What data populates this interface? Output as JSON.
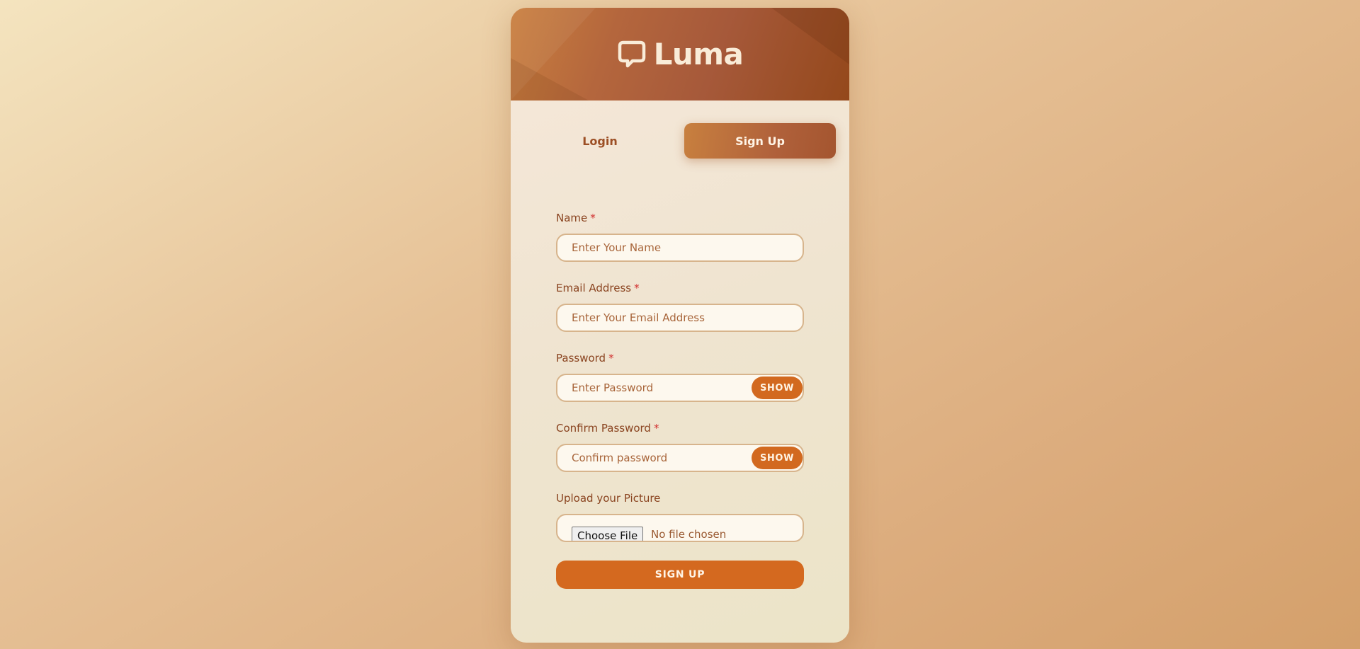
{
  "brand": {
    "name": "Luma",
    "icon": "chat-bubble-icon"
  },
  "tabs": [
    {
      "label": "Login",
      "active": false
    },
    {
      "label": "Sign Up",
      "active": true
    }
  ],
  "form": {
    "name": {
      "label": "Name",
      "required_mark": "*",
      "placeholder": "Enter Your Name",
      "value": ""
    },
    "email": {
      "label": "Email Address",
      "required_mark": "*",
      "placeholder": "Enter Your Email Address",
      "value": ""
    },
    "password": {
      "label": "Password",
      "required_mark": "*",
      "placeholder": "Enter Password",
      "value": "",
      "toggle_label": "SHOW"
    },
    "confirm_password": {
      "label": "Confirm Password",
      "required_mark": "*",
      "placeholder": "Confirm password",
      "value": "",
      "toggle_label": "SHOW"
    },
    "picture": {
      "label": "Upload your Picture",
      "button_label": "Choose File",
      "status": "No file chosen"
    },
    "submit_label": "SIGN UP"
  },
  "colors": {
    "accent": "#d4691f",
    "header_brown": "#a6593a",
    "label_text": "#8a4420",
    "required": "#d12e2e"
  }
}
